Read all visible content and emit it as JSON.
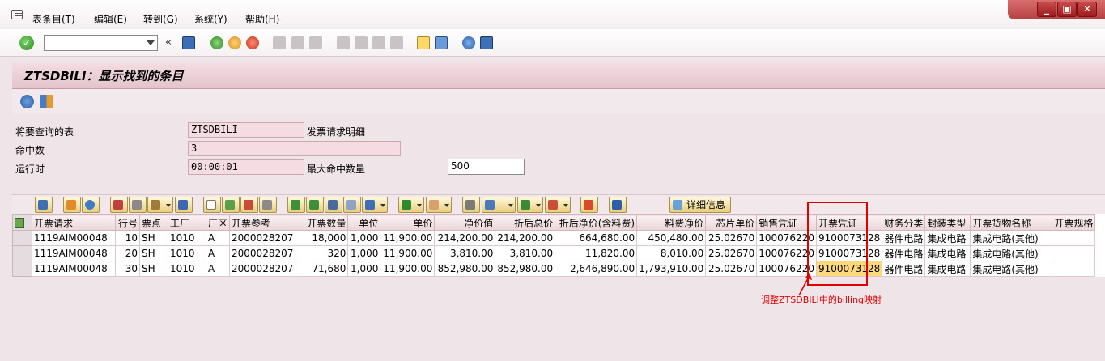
{
  "menu": {
    "items": [
      "表条目(T)",
      "编辑(E)",
      "转到(G)",
      "系统(Y)",
      "帮助(H)"
    ]
  },
  "window": {
    "minimize": "_",
    "restore": "▣",
    "close": "✕"
  },
  "toolbar": {
    "command_field_value": "",
    "nav_arrows": "«"
  },
  "title": "ZTSDBILI：显示找到的条目",
  "info": {
    "table_label": "将要查询的表",
    "table_value": "ZTSDBILI",
    "table_desc": "发票请求明细",
    "hits_label": "命中数",
    "hits_value": "3",
    "runtime_label": "运行时",
    "runtime_value": "00:00:01",
    "max_hits_label": "最大命中数量",
    "max_hits_value": "500"
  },
  "alv": {
    "detail_button": "详细信息"
  },
  "grid": {
    "headers": [
      "开票请求",
      "行号",
      "票点",
      "工厂",
      "厂区",
      "开票参考",
      "开票数量",
      "单位",
      "单价",
      "净价值",
      "折后总价",
      "折后净价(含料费)",
      "料费净价",
      "芯片单价",
      "销售凭证",
      "开票凭证",
      "财务分类",
      "封装类型",
      "开票货物名称",
      "开票规格"
    ],
    "rows": [
      [
        "1119AIM00048",
        "10",
        "SH",
        "1010",
        "A",
        "2000028207",
        "18,000",
        "1,000",
        "11,900.00",
        "214,200.00",
        "214,200.00",
        "664,680.00",
        "450,480.00",
        "25.02670",
        "100076220",
        "9100073128",
        "器件电路",
        "集成电路",
        "集成电路(其他)",
        ""
      ],
      [
        "1119AIM00048",
        "20",
        "SH",
        "1010",
        "A",
        "2000028207",
        "320",
        "1,000",
        "11,900.00",
        "3,810.00",
        "3,810.00",
        "11,820.00",
        "8,010.00",
        "25.02670",
        "100076220",
        "9100073128",
        "器件电路",
        "集成电路",
        "集成电路(其他)",
        ""
      ],
      [
        "1119AIM00048",
        "30",
        "SH",
        "1010",
        "A",
        "2000028207",
        "71,680",
        "1,000",
        "11,900.00",
        "852,980.00",
        "852,980.00",
        "2,646,890.00",
        "1,793,910.00",
        "25.02670",
        "100076220",
        "9100073128",
        "器件电路",
        "集成电路",
        "集成电路(其他)",
        ""
      ]
    ]
  },
  "annotation": {
    "text": "调整ZTSDBILI中的billing映射"
  },
  "colors": {
    "highlight_cell": "#ffd87a",
    "annotation_red": "#e00000",
    "title_bg": "#e8cdd4"
  }
}
